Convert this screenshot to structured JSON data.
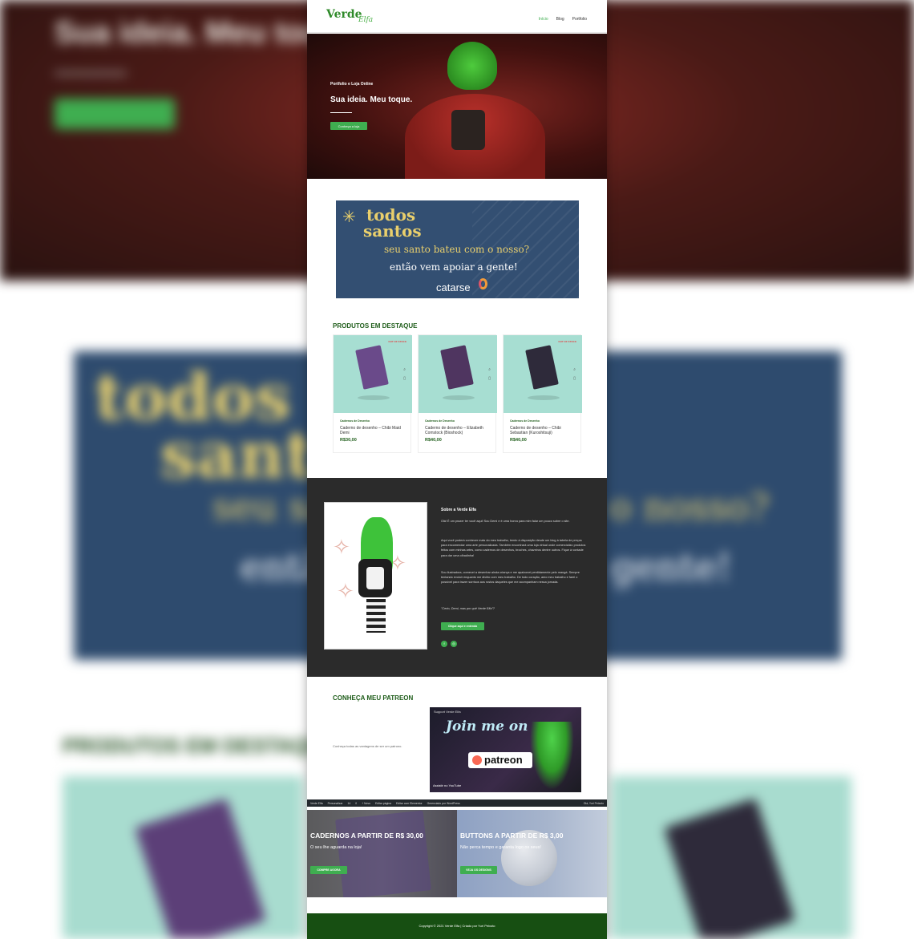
{
  "header": {
    "logo_main": "Verde",
    "logo_sub": "Elfa",
    "nav": [
      "Início",
      "Blog",
      "Portfolio"
    ]
  },
  "hero": {
    "subtitle": "Portfolio e Loja Online",
    "title": "Sua ideia. Meu toque.",
    "button": "Conheça a loja"
  },
  "banner": {
    "line1": "todos",
    "line2": "santos",
    "line3": "seu santo bateu com o nosso?",
    "line4": "então vem apoiar a gente!",
    "brand": "catarse"
  },
  "featured": {
    "title": "PRODUTOS EM DESTAQUE",
    "products": [
      {
        "badge": "OUT OF STOCK",
        "category": "Cadernos de Desenho",
        "name": "Caderno de desenho – Chibi Maid Demi",
        "price": "R$30,00",
        "color": "#6a4a8a"
      },
      {
        "badge": "",
        "category": "Cadernos de Desenho",
        "name": "Caderno de desenho – Elizabeth Comstock (Bioshock)",
        "price": "R$40,00",
        "color": "#4f3560"
      },
      {
        "badge": "OUT OF STOCK",
        "category": "Cadernos de Desenho",
        "name": "Caderno de desenho – Chibi Sebastian (Kuroshitsuji)",
        "price": "R$40,00",
        "color": "#2e2a3a"
      }
    ]
  },
  "about": {
    "title": "Sobre a Verde Elfa",
    "p1": "Olá! É um prazer ter você aqui! Sou Demi e é uma honra para mim falar um pouco sobre o site.",
    "p2": "Aqui você poderá conhecer mais do meu trabalho, tendo à disposição desde um blog à tabela de preços para encomendar uma arte personalizada. Também encontrará uma loja virtual onde comercializo produtos feitos com minhas artes, como cadernos de desenhos, broches, chaveiros dentre outros. Fique à vontade para dar uma olhadinha!",
    "p3": "Sou ilustradora, comecei a desenhar ainda criança e me apaixonei perdidamente pelo mangá. Sempre tentando evoluir enquanto me divirto com meu trabalho. De todo coração, amo meu trabalho e farei o possível para trazer sorrisos aos rostos daqueles que me acompanham nessa jornada.",
    "p4": "\"Certo, Demi, mas por quê Verde Elfa\"?",
    "button": "Clique aqui e entenda",
    "social": [
      "f",
      "◎"
    ]
  },
  "patreon": {
    "title": "CONHEÇA MEU PATREON",
    "text": "Conheça todas as vantagens de ser um patrono.",
    "video_title": "Support Verde Elfa",
    "video_headline": "Join me on",
    "video_brand": "patreon",
    "video_footer": "Assistir no YouTube"
  },
  "adminbar": {
    "items": [
      "Verde Elfa",
      "Personalizar",
      "14",
      "0",
      "+ Novo",
      "Editar página",
      "Editar com Elementor",
      "Gerenciado por WordPress"
    ],
    "right": "Olá, Yuri Peixoto"
  },
  "promos": [
    {
      "title": "CADERNOS A PARTIR DE R$ 30,00",
      "subtitle": "O seu lhe aguarda na loja!",
      "button": "COMPRE AGORA"
    },
    {
      "title": "BUTTONS A PARTIR DE R$ 3,00",
      "subtitle": "Não perca tempo e garanta logo os seus!",
      "button": "VEJA OS DESIGNS"
    }
  ],
  "footer": {
    "text": "Copyright © 2021 Verde Elfa | Criado por Yuri Peixoto"
  },
  "colors": {
    "accent": "#3fae50",
    "dark_green": "#174f12",
    "about_bg": "#2b2b2b",
    "banner_bg": "#334f72"
  }
}
